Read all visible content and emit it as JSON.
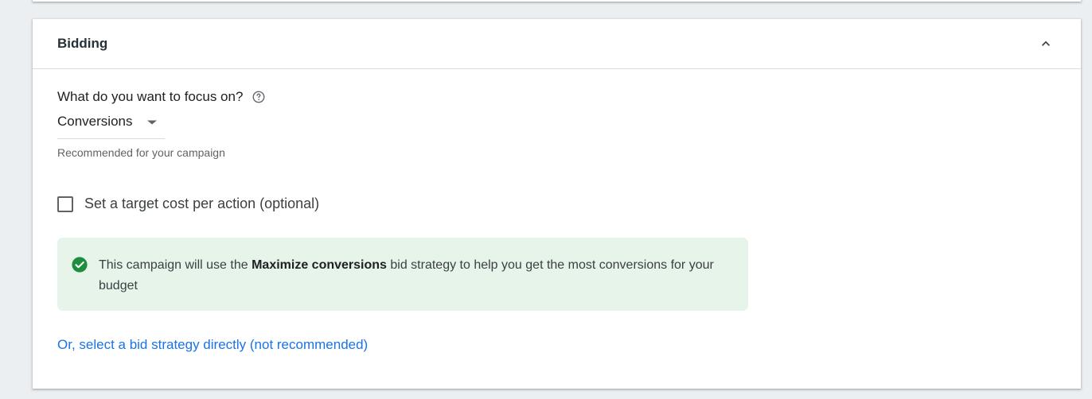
{
  "section": {
    "title": "Bidding"
  },
  "focus": {
    "label": "What do you want to focus on?",
    "selected": "Conversions",
    "hint": "Recommended for your campaign"
  },
  "target_cpa": {
    "label": "Set a target cost per action (optional)",
    "checked": false
  },
  "info": {
    "prefix": "This campaign will use the ",
    "strategy": "Maximize conversions",
    "suffix": " bid strategy to help you get the most conversions for your budget"
  },
  "link": {
    "label": "Or, select a bid strategy directly (not recommended)"
  },
  "colors": {
    "link": "#1a73e8",
    "info_background": "#e6f4ea",
    "check_icon": "#1e8e3e"
  },
  "icons": {
    "collapse": "chevron-up-icon",
    "help": "help-circle-icon",
    "dropdown": "dropdown-arrow-icon",
    "info": "check-circle-icon"
  }
}
